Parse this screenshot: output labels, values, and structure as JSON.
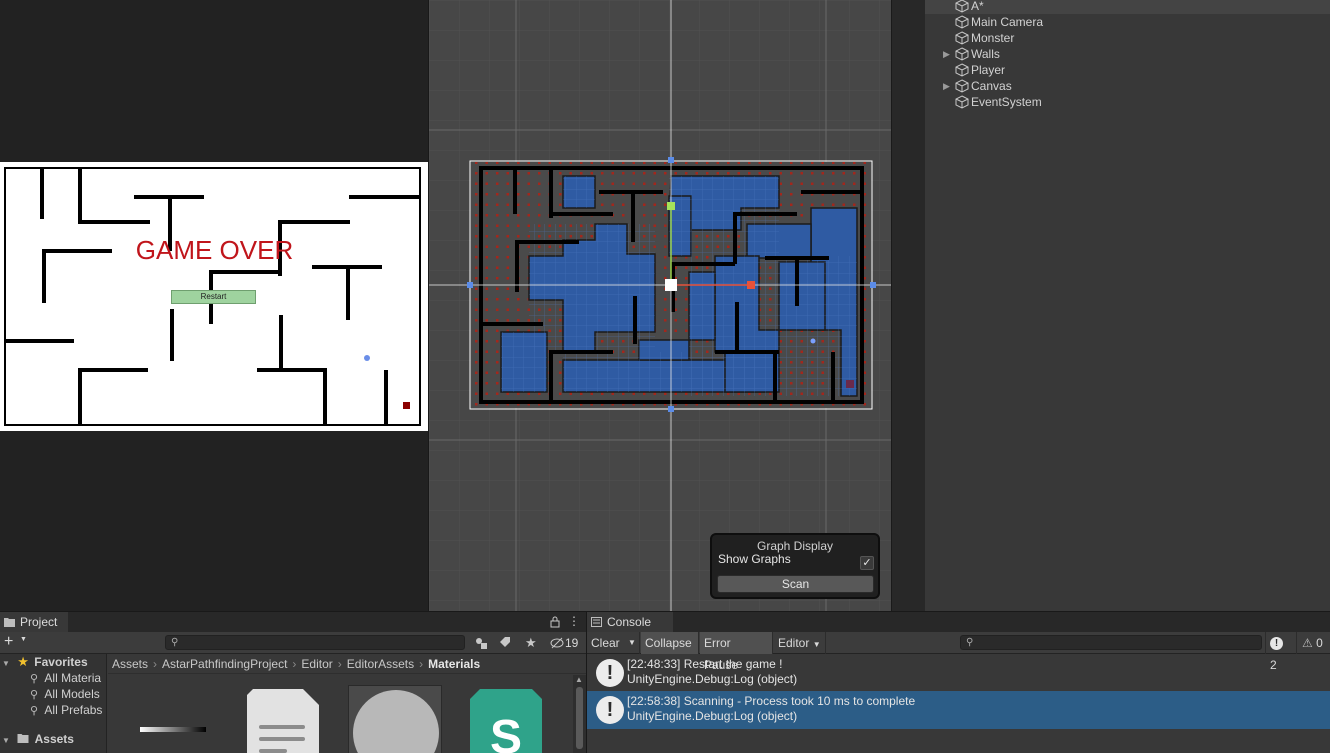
{
  "game_view": {
    "game_over_text": "GAME OVER",
    "restart_label": "Restart"
  },
  "graph_display": {
    "title": "Graph Display",
    "show_graphs_label": "Show Graphs",
    "show_graphs_checked": true,
    "scan_label": "Scan"
  },
  "hierarchy": {
    "items": [
      {
        "label": "A*",
        "expandable": false
      },
      {
        "label": "Main Camera",
        "expandable": false
      },
      {
        "label": "Monster",
        "expandable": false
      },
      {
        "label": "Walls",
        "expandable": true
      },
      {
        "label": "Player",
        "expandable": false
      },
      {
        "label": "Canvas",
        "expandable": true
      },
      {
        "label": "EventSystem",
        "expandable": false
      }
    ]
  },
  "project": {
    "tab_label": "Project",
    "add_label": "+",
    "hidden_count": "19",
    "favorites_label": "Favorites",
    "favorites": [
      "All Materia",
      "All Models",
      "All Prefabs"
    ],
    "assets_label": "Assets",
    "breadcrumb": [
      "Assets",
      "AstarPathfindingProject",
      "Editor",
      "EditorAssets",
      "Materials"
    ]
  },
  "console": {
    "tab_label": "Console",
    "clear_label": "Clear",
    "collapse_label": "Collapse",
    "error_pause_label": "Error Pause",
    "editor_label": "Editor",
    "info_count": "2",
    "warning_count": "0",
    "logs": [
      {
        "line1": "[22:48:33] Restart the game !",
        "line2": "UnityEngine.Debug:Log (object)",
        "selected": false
      },
      {
        "line1": "[22:58:38] Scanning - Process took 10 ms to complete",
        "line2": "UnityEngine.Debug:Log (object)",
        "selected": true
      }
    ]
  },
  "colors": {
    "selection": "#2c5d87",
    "accent_blue": "#2f5ba3",
    "graph_red": "#a3271c",
    "game_over_red": "#c0151b",
    "restart_green": "#9fd39f"
  }
}
